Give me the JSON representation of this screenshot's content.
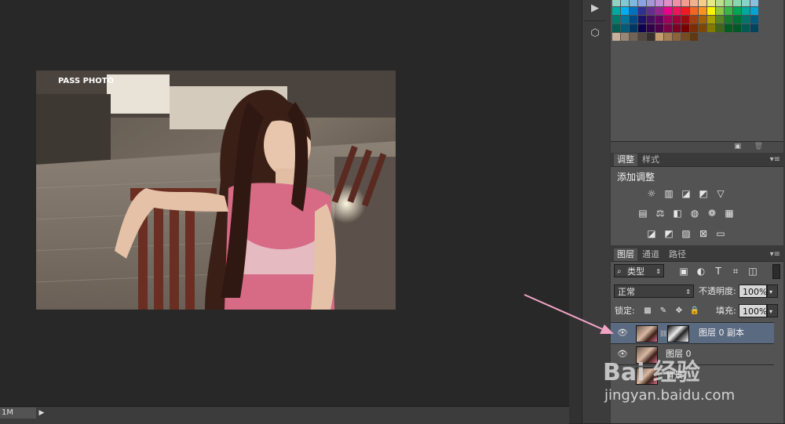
{
  "status": {
    "zoom": "1M",
    "arrow": "▶"
  },
  "dock": {
    "btn1": "▶",
    "btn2": "⬡"
  },
  "photo": {
    "watermark_top": "PASS PHOTO"
  },
  "adjustments": {
    "tabs": [
      "调整",
      "样式"
    ],
    "title": "添加调整",
    "icon_rows": [
      [
        "brightness-icon",
        "levels-icon",
        "curves-icon",
        "exposure-icon",
        "vibrance-icon"
      ],
      [
        "hue-saturation-icon",
        "color-balance-icon",
        "black-white-icon",
        "photo-filter-icon",
        "channel-mixer-icon",
        "color-lookup-icon"
      ],
      [
        "invert-icon",
        "posterize-icon",
        "threshold-icon",
        "selective-color-icon",
        "gradient-map-icon"
      ]
    ]
  },
  "layers": {
    "tabs": [
      "图层",
      "通道",
      "路径"
    ],
    "filter": "类型",
    "blend_mode": "正常",
    "opacity_label": "不透明度:",
    "opacity": "100%",
    "lock_label": "锁定:",
    "fill_label": "填充:",
    "fill": "100%",
    "items": [
      {
        "name": "图层 0 副本",
        "selected": true
      },
      {
        "name": "图层 0",
        "selected": false
      },
      {
        "name": "背景",
        "selected": false
      }
    ]
  },
  "watermark": {
    "logo": "Bai 经验",
    "url": "jingyan.baidu.com"
  },
  "colors": {
    "panel": "#535353",
    "selected_row": "#5a6a80",
    "arrow": "#f2a3c4"
  }
}
